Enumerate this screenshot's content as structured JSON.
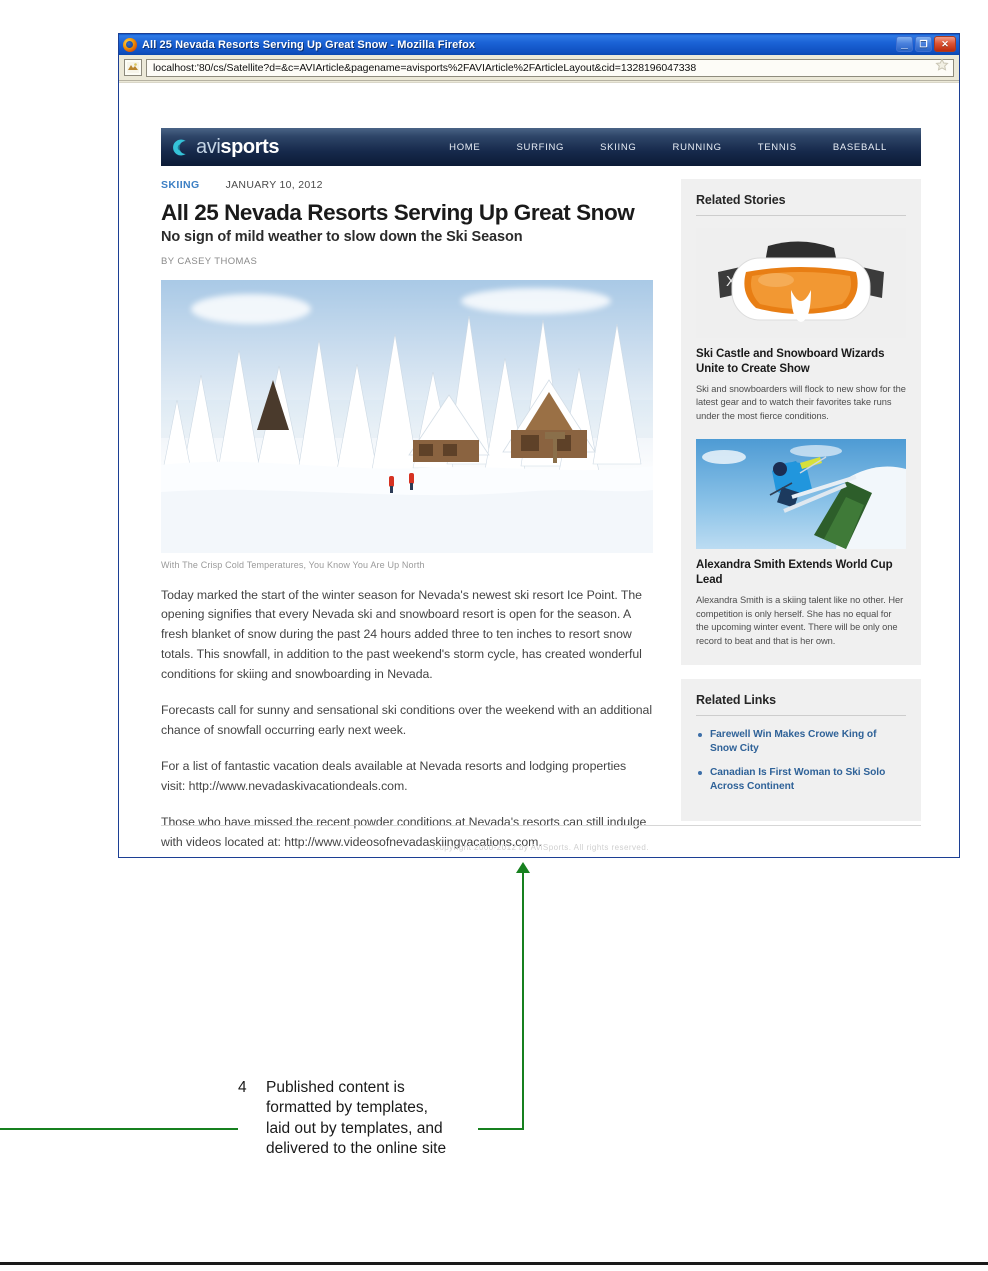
{
  "browser": {
    "title": "All 25 Nevada Resorts Serving Up Great Snow - Mozilla Firefox",
    "url": "localhost:'80/cs/Satellite?d=&c=AVIArticle&pagename=avisports%2FAVIArticle%2FArticleLayout&cid=1328196047338",
    "minimize_label": "_",
    "restore_label": "❐",
    "close_label": "✕"
  },
  "site": {
    "logo_prefix": "avi",
    "logo_suffix": "sports",
    "nav": [
      {
        "label": "HOME"
      },
      {
        "label": "SURFING"
      },
      {
        "label": "SKIING"
      },
      {
        "label": "RUNNING"
      },
      {
        "label": "TENNIS"
      },
      {
        "label": "BASEBALL"
      }
    ],
    "copyright": "Copyright 2000-2012 by AviSports. All rights reserved."
  },
  "article": {
    "kicker": "SKIING",
    "date": "JANUARY 10, 2012",
    "headline": "All 25 Nevada Resorts Serving Up Great Snow",
    "subhead": "No sign of mild weather to slow down the Ski Season",
    "byline": "BY CASEY THOMAS",
    "image_caption": "With The Crisp Cold Temperatures, You Know You Are Up North",
    "paragraphs": [
      "Today marked the start of the winter season for Nevada's newest ski resort Ice Point. The opening signifies that every Nevada ski and snowboard resort is open for the season. A fresh blanket of snow during the past 24 hours added three to ten inches to resort snow totals. This snowfall, in addition to the past weekend's storm cycle, has created wonderful conditions for skiing and snowboarding in Nevada.",
      "Forecasts call for sunny and sensational ski conditions over the weekend with an additional chance of snowfall occurring early next week.",
      "For a list of fantastic vacation deals available at Nevada resorts and lodging properties visit: http://www.nevadaskivacationdeals.com.",
      "Those who have missed the recent powder conditions at Nevada's resorts can still indulge with videos located at: http://www.videosofnevadaskiingvacations.com."
    ]
  },
  "sidebar": {
    "related_stories_title": "Related Stories",
    "stories": [
      {
        "title": "Ski Castle and Snowboard Wizards Unite to Create Show",
        "summary": "Ski and snowboarders will flock to new show for the latest gear and to watch their favorites take runs under the most fierce conditions."
      },
      {
        "title": "Alexandra Smith Extends World Cup Lead",
        "summary": "Alexandra Smith is a skiing talent like no other. Her competition is only herself. She has no equal for the upcoming winter event. There will be only one record to beat and that is her own."
      }
    ],
    "related_links_title": "Related Links",
    "links": [
      {
        "label": "Farewell Win Makes Crowe King of Snow City"
      },
      {
        "label": "Canadian Is First Woman to Ski Solo Across Continent"
      }
    ]
  },
  "callout": {
    "number": "4",
    "lines": [
      "Published content is",
      "formatted by templates,",
      "laid out by templates, and",
      "delivered to the online site"
    ]
  },
  "colors": {
    "accent_green": "#17801f",
    "link_blue": "#2f6298",
    "kicker_blue": "#3c7fc4",
    "nav_dark": "#16294b",
    "titlebar_blue": "#1b63d6"
  }
}
